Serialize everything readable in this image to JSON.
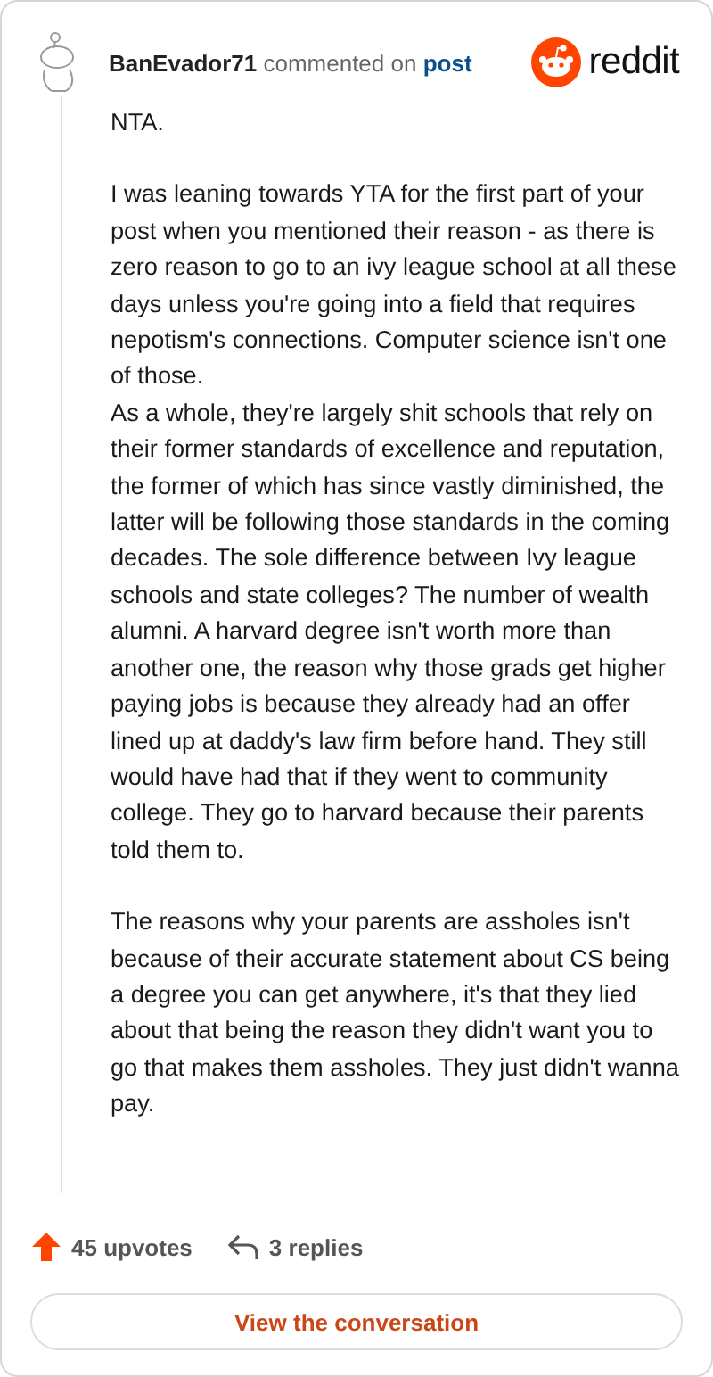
{
  "header": {
    "username": "BanEvador71",
    "action": "commented on",
    "link": "post",
    "brand": "reddit"
  },
  "paragraphs": [
    "NTA.",
    "I was leaning towards YTA for the first part of your post when you mentioned their reason - as there is zero reason to go to an ivy league school at all these days unless you're going into a field that requires nepotism's connections. Computer science isn't one of those.\nAs a whole, they're largely shit schools that rely on their former standards of excellence and reputation, the former of which has since vastly diminished, the latter will be following those standards in the coming decades. The sole difference between Ivy league schools and state colleges? The number of wealth alumni. A harvard degree isn't worth more than another one, the reason why those grads get higher paying jobs is because they already had an offer lined up at daddy's law firm before hand. They still would have had that if they went to community college. They go to harvard because their parents told them to.",
    "The reasons why your parents are assholes isn't because of their accurate statement about CS being a degree you can get anywhere, it's that they lied about that being the reason they didn't want you to go that makes them assholes. They just didn't wanna pay."
  ],
  "footer": {
    "upvotes": "45 upvotes",
    "replies": "3 replies",
    "button": "View the conversation"
  }
}
